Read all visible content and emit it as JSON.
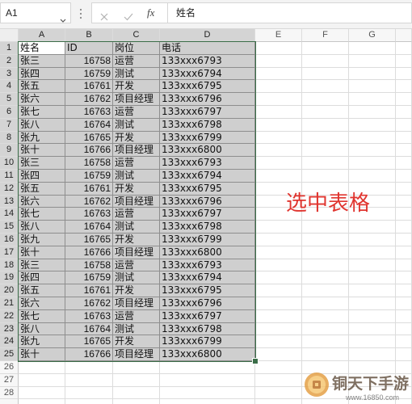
{
  "formula_bar": {
    "name_box": "A1",
    "name_box_dropdown_icon": "chevron-down-icon",
    "resize_handle_icon": "vertical-dots-icon",
    "cancel_icon": "close-icon",
    "enter_icon": "check-icon",
    "fx_label": "fx",
    "formula": "姓名"
  },
  "columns": [
    "A",
    "B",
    "C",
    "D",
    "E",
    "F",
    "G"
  ],
  "selection": {
    "rows": [
      1,
      25
    ],
    "cols": [
      1,
      4
    ]
  },
  "rows": [
    {
      "num": "1",
      "cells": [
        "姓名",
        "ID",
        "岗位",
        "电话"
      ]
    },
    {
      "num": "2",
      "cells": [
        "张三",
        "16758",
        "运营",
        "133xxx6793"
      ]
    },
    {
      "num": "3",
      "cells": [
        "张四",
        "16759",
        "测试",
        "133xxx6794"
      ]
    },
    {
      "num": "4",
      "cells": [
        "张五",
        "16761",
        "开发",
        "133xxx6795"
      ]
    },
    {
      "num": "5",
      "cells": [
        "张六",
        "16762",
        "项目经理",
        "133xxx6796"
      ]
    },
    {
      "num": "6",
      "cells": [
        "张七",
        "16763",
        "运营",
        "133xxx6797"
      ]
    },
    {
      "num": "7",
      "cells": [
        "张八",
        "16764",
        "测试",
        "133xxx6798"
      ]
    },
    {
      "num": "8",
      "cells": [
        "张九",
        "16765",
        "开发",
        "133xxx6799"
      ]
    },
    {
      "num": "9",
      "cells": [
        "张十",
        "16766",
        "项目经理",
        "133xxx6800"
      ]
    },
    {
      "num": "10",
      "cells": [
        "张三",
        "16758",
        "运营",
        "133xxx6793"
      ]
    },
    {
      "num": "11",
      "cells": [
        "张四",
        "16759",
        "测试",
        "133xxx6794"
      ]
    },
    {
      "num": "12",
      "cells": [
        "张五",
        "16761",
        "开发",
        "133xxx6795"
      ]
    },
    {
      "num": "13",
      "cells": [
        "张六",
        "16762",
        "项目经理",
        "133xxx6796"
      ]
    },
    {
      "num": "14",
      "cells": [
        "张七",
        "16763",
        "运营",
        "133xxx6797"
      ]
    },
    {
      "num": "15",
      "cells": [
        "张八",
        "16764",
        "测试",
        "133xxx6798"
      ]
    },
    {
      "num": "16",
      "cells": [
        "张九",
        "16765",
        "开发",
        "133xxx6799"
      ]
    },
    {
      "num": "17",
      "cells": [
        "张十",
        "16766",
        "项目经理",
        "133xxx6800"
      ]
    },
    {
      "num": "18",
      "cells": [
        "张三",
        "16758",
        "运营",
        "133xxx6793"
      ]
    },
    {
      "num": "19",
      "cells": [
        "张四",
        "16759",
        "测试",
        "133xxx6794"
      ]
    },
    {
      "num": "20",
      "cells": [
        "张五",
        "16761",
        "开发",
        "133xxx6795"
      ]
    },
    {
      "num": "21",
      "cells": [
        "张六",
        "16762",
        "项目经理",
        "133xxx6796"
      ]
    },
    {
      "num": "22",
      "cells": [
        "张七",
        "16763",
        "运营",
        "133xxx6797"
      ]
    },
    {
      "num": "23",
      "cells": [
        "张八",
        "16764",
        "测试",
        "133xxx6798"
      ]
    },
    {
      "num": "24",
      "cells": [
        "张九",
        "16765",
        "开发",
        "133xxx6799"
      ]
    },
    {
      "num": "25",
      "cells": [
        "张十",
        "16766",
        "项目经理",
        "133xxx6800"
      ]
    },
    {
      "num": "26",
      "cells": []
    },
    {
      "num": "27",
      "cells": []
    },
    {
      "num": "28",
      "cells": []
    }
  ],
  "annotation": "选中表格",
  "watermark": {
    "name": "铜天下手游",
    "url": "www.16850.com"
  },
  "colors": {
    "selection_fill": "#cfcfcf",
    "selection_border": "#3b6d48",
    "annotation": "#e0352f"
  }
}
